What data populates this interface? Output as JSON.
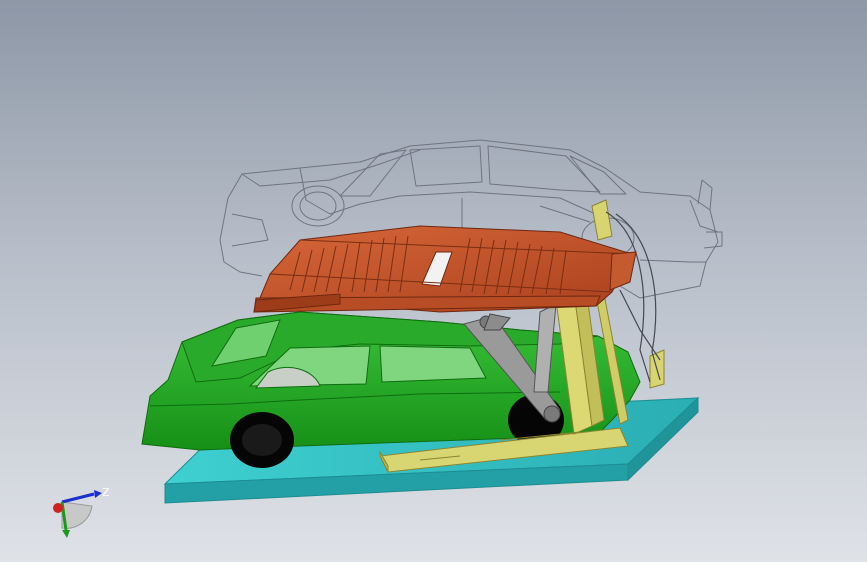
{
  "scene": {
    "model": "lift-parking-assembly",
    "components": [
      {
        "name": "base-plate",
        "color": "#2fbfc2"
      },
      {
        "name": "lower-car",
        "color": "#1ea01e"
      },
      {
        "name": "upper-car-wireframe",
        "color": "#c9ced6"
      },
      {
        "name": "tilting-platform",
        "color": "#c8552a"
      },
      {
        "name": "lift-frame",
        "color": "#d6d36a"
      },
      {
        "name": "hydraulic-arm",
        "color": "#8e8e8e"
      }
    ]
  },
  "triad": {
    "axes": [
      {
        "name": "Z",
        "color": "#1a2fd0"
      },
      {
        "name": "Y",
        "color": "#1a9a1a"
      },
      {
        "name": "X",
        "color": "#d02020"
      }
    ],
    "visible_label": "Z"
  }
}
